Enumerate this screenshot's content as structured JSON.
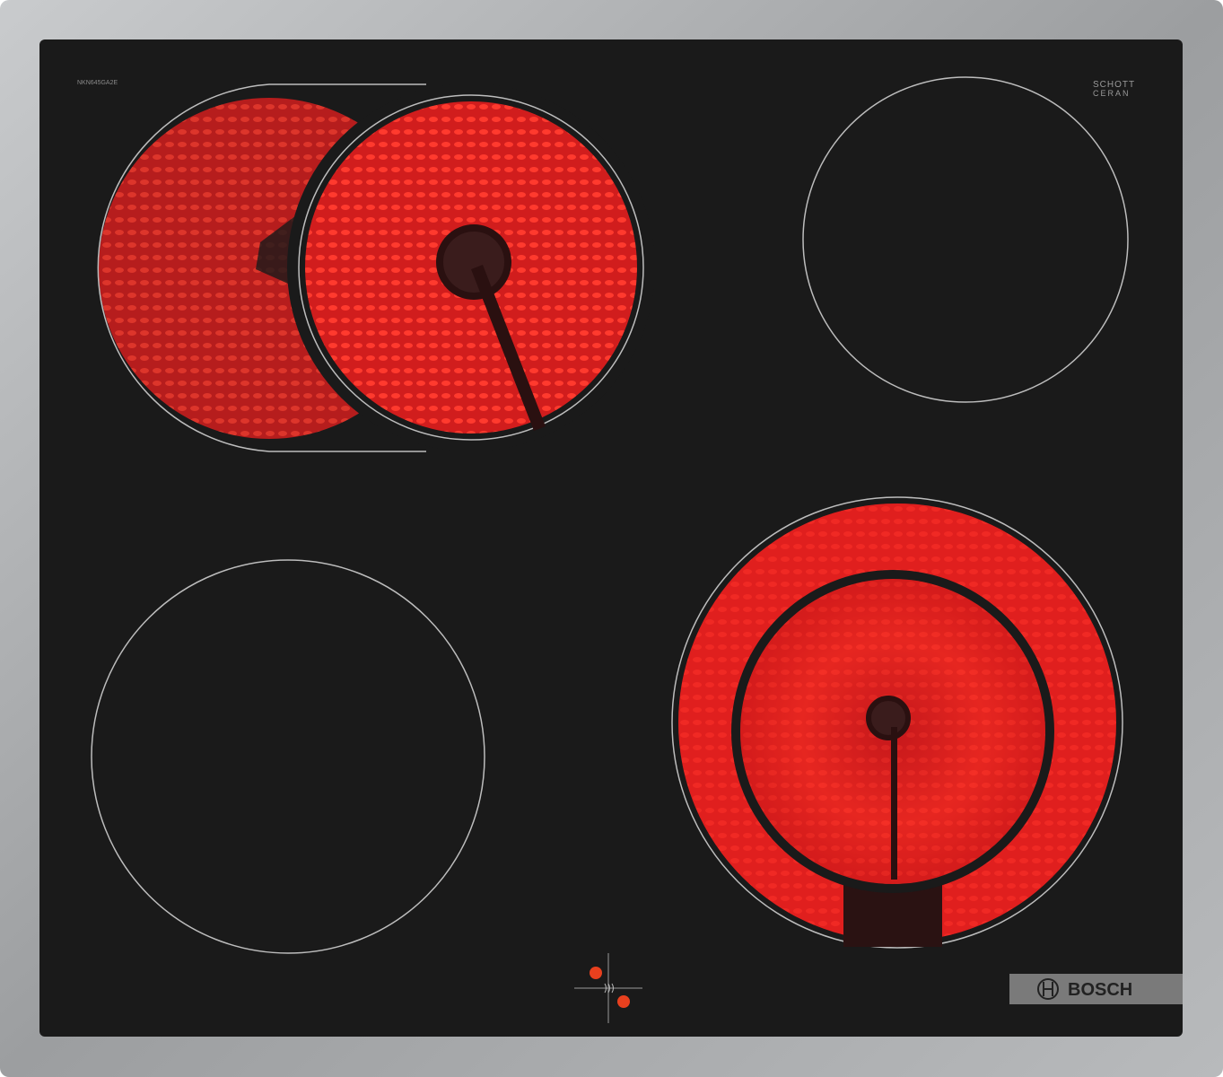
{
  "product": {
    "model_label": "NKN645GA2E",
    "glass_brand_line1": "SCHOTT",
    "glass_brand_line2": "CERAN",
    "brand": "BOSCH"
  },
  "zones": [
    {
      "name": "front-left-dual",
      "state": "on"
    },
    {
      "name": "rear-right",
      "state": "off"
    },
    {
      "name": "rear-left",
      "state": "off"
    },
    {
      "name": "front-right-dual",
      "state": "on"
    }
  ],
  "indicators": {
    "residual_heat_count": 2
  },
  "colors": {
    "glass": "#1a1a1a",
    "frame": "#a9abad",
    "heat_red": "#e8201e",
    "zone_outline": "#bdbdbd",
    "badge": "#7a7a7a"
  }
}
